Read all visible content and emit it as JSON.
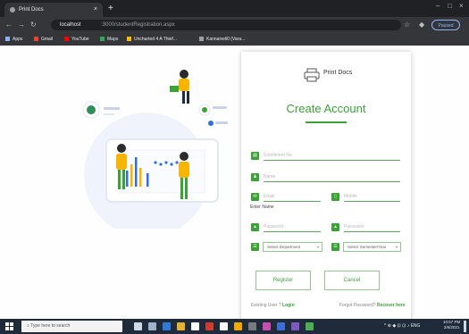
{
  "browser": {
    "tab_title": "Print Docs",
    "tab_close": "×",
    "new_tab": "+",
    "window_controls": [
      "⌄",
      "–",
      "□",
      "×"
    ],
    "url_host": "localhost",
    "url_path": ":3000/studentRegistration.aspx",
    "paused_label": "Paused",
    "bookmarks": [
      {
        "label": "Apps",
        "color": "#8ab4f8"
      },
      {
        "label": "Gmail",
        "color": "#ea4335"
      },
      {
        "label": "YouTube",
        "color": "#ff0000"
      },
      {
        "label": "Maps",
        "color": "#34a853"
      },
      {
        "label": "Uncharted 4 A Thief...",
        "color": "#fbbc05"
      },
      {
        "label": "Kannaiveli0 (Vara...",
        "color": "#9aa0a6"
      }
    ]
  },
  "app": {
    "brand": "Print Docs",
    "title": "Create Account",
    "fields": {
      "enrollment_placeholder": "Enrollment No",
      "name_placeholder": "Name",
      "email_placeholder": "Email",
      "mobile_placeholder": "Mobile",
      "name_error": "Enter Name",
      "password_placeholder": "Password",
      "confirm_placeholder": "Password",
      "department_value": "Select Department",
      "semester_value": "Select Semester/Year"
    },
    "buttons": {
      "register": "Register",
      "cancel": "Cancel"
    },
    "footer": {
      "existing_text": "Existing User ?",
      "login_link": "Login",
      "forgot_text": "Forgot Password?",
      "recover_link": "Recover here"
    },
    "accent_color": "#3aa335"
  },
  "taskbar": {
    "search_placeholder": "Type here to search",
    "tray_text": "^ ⊕ ◆ ⊡ ⊡ ♪ ENG",
    "time": "10:57 PM",
    "date": "2/6/2021"
  }
}
